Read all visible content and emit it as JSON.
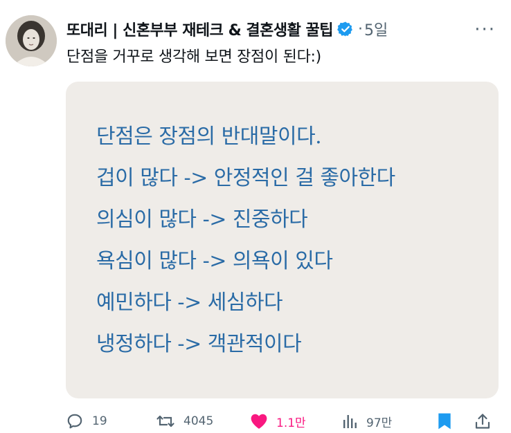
{
  "tweet": {
    "author": "또대리 | 신혼부부 재테크 & 결혼생활 꿀팁",
    "separator": "·",
    "time": "5일",
    "text": "단점을 거꾸로 생각해 보면 장점이 된다:)"
  },
  "media": {
    "lines": [
      "단점은 장점의 반대말이다.",
      "겁이 많다 -> 안정적인 걸 좋아한다",
      "의심이 많다 -> 진중하다",
      "욕심이 많다 -> 의욕이 있다",
      "예민하다 -> 세심하다",
      "냉정하다 -> 객관적이다"
    ]
  },
  "actions": {
    "replies": "19",
    "retweets": "4045",
    "likes": "1.1만",
    "views": "97만"
  },
  "colors": {
    "media_text": "#2a6ba6",
    "media_bg": "#efece8",
    "like": "#f91880",
    "accent": "#1d9bf0",
    "muted": "#536471"
  }
}
